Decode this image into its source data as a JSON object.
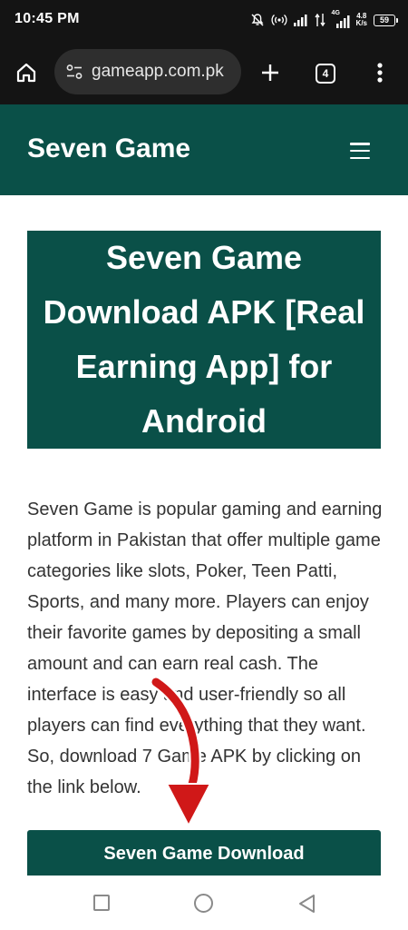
{
  "status_bar": {
    "time": "10:45 PM",
    "net_speed_value": "4.8",
    "net_speed_unit": "K/s",
    "network_type": "4G",
    "battery": "59",
    "icons": [
      "bell-off-icon",
      "hotspot-icon",
      "signal-icon",
      "data-arrows-icon",
      "signal-4g-icon",
      "battery-icon"
    ]
  },
  "browser": {
    "url": "gameapp.com.pk",
    "tab_count": "4",
    "icons": [
      "home-icon",
      "site-info-icon",
      "plus-icon",
      "tabs-icon",
      "more-vert-icon"
    ]
  },
  "site": {
    "title": "Seven Game",
    "menu_icon": "hamburger-icon"
  },
  "article": {
    "heading": "Seven Game Download APK [Real Earning App] for Android",
    "intro": "Seven Game is popular gaming and earning platform in Pakistan that offer multiple game categories like slots, Poker, Teen Patti, Sports, and many more. Players can enjoy their favorite games by depositing a small amount and can earn real cash. The interface is easy and user-friendly so all players can find everything that they want. So, download 7 Game APK by clicking on the link below.",
    "download_label": "Seven Game Download"
  },
  "colors": {
    "brand": "#0a5048",
    "arrow": "#d01818",
    "system_bar": "#141414"
  },
  "nav_bar": {
    "icons": [
      "recents-icon",
      "home-circle-icon",
      "back-icon"
    ]
  }
}
